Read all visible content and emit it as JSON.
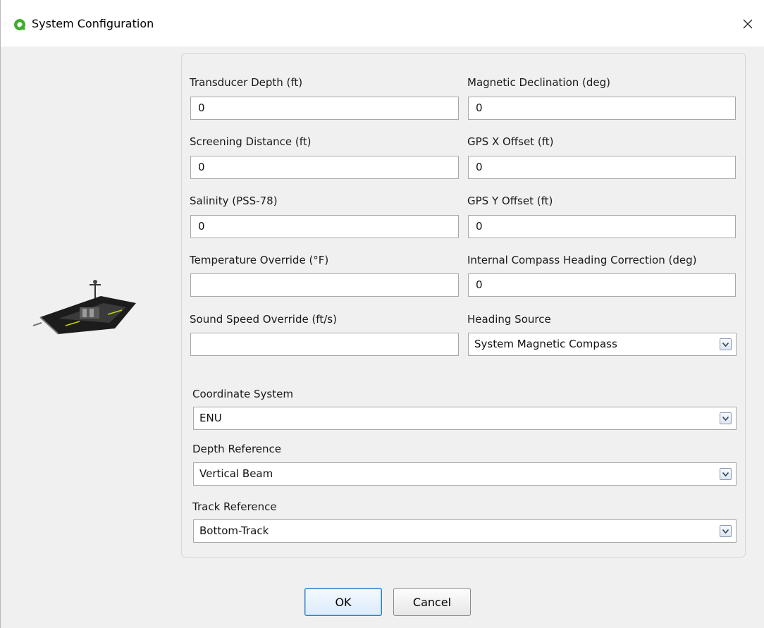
{
  "window": {
    "title": "System Configuration"
  },
  "fields": {
    "transducer_depth": {
      "label": "Transducer Depth (ft)",
      "value": "0"
    },
    "magnetic_declination": {
      "label": "Magnetic Declination (deg)",
      "value": "0"
    },
    "screening_distance": {
      "label": "Screening Distance (ft)",
      "value": "0"
    },
    "gps_x_offset": {
      "label": "GPS X Offset (ft)",
      "value": "0"
    },
    "salinity": {
      "label": "Salinity (PSS-78)",
      "value": "0"
    },
    "gps_y_offset": {
      "label": "GPS Y Offset (ft)",
      "value": "0"
    },
    "temperature_override": {
      "label": "Temperature Override (°F)",
      "value": ""
    },
    "compass_heading_correction": {
      "label": "Internal Compass Heading Correction (deg)",
      "value": "0"
    },
    "sound_speed_override": {
      "label": "Sound Speed Override (ft/s)",
      "value": ""
    }
  },
  "selects": {
    "heading_source": {
      "label": "Heading Source",
      "value": "System Magnetic Compass"
    },
    "coordinate_system": {
      "label": "Coordinate System",
      "value": "ENU"
    },
    "depth_reference": {
      "label": "Depth Reference",
      "value": "Vertical Beam"
    },
    "track_reference": {
      "label": "Track Reference",
      "value": "Bottom-Track"
    }
  },
  "buttons": {
    "ok": "OK",
    "cancel": "Cancel"
  },
  "colors": {
    "app_icon": "#3dae2b",
    "focus_border": "#2f78c8"
  }
}
